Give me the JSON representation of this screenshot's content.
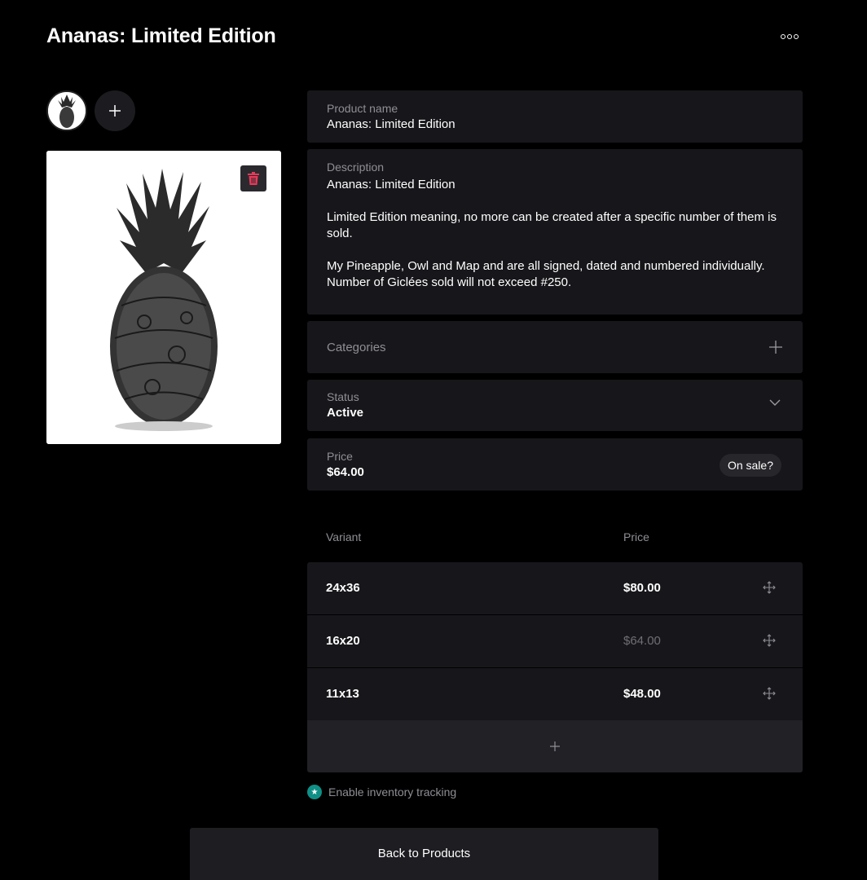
{
  "header": {
    "title": "Ananas: Limited Edition",
    "more_icon": "more-horizontal-icon"
  },
  "images": {
    "thumbnail_alt": "Pineapple illustration thumbnail",
    "main_alt": "Pineapple illustration",
    "add_icon": "plus-icon",
    "delete_icon": "trash-icon",
    "delete_color": "#e8395a"
  },
  "form": {
    "product_name": {
      "label": "Product name",
      "value": "Ananas: Limited Edition"
    },
    "description": {
      "label": "Description",
      "value": "Ananas: Limited Edition\n\nLimited Edition meaning, no more can be created after a specific number of them is sold.\n\nMy Pineapple, Owl and Map and are all signed, dated and numbered individually. Number of Giclées sold will not exceed #250."
    },
    "categories": {
      "label": "Categories",
      "add_icon": "plus-icon"
    },
    "status": {
      "label": "Status",
      "value": "Active",
      "icon": "chevron-down-icon"
    },
    "price": {
      "label": "Price",
      "value": "$64.00",
      "sale_button": "On sale?"
    }
  },
  "variants": {
    "headers": {
      "variant": "Variant",
      "price": "Price"
    },
    "rows": [
      {
        "name": "24x36",
        "price": "$80.00",
        "muted": false
      },
      {
        "name": "16x20",
        "price": "$64.00",
        "muted": true
      },
      {
        "name": "11x13",
        "price": "$48.00",
        "muted": false
      }
    ],
    "drag_icon": "move-icon",
    "add_icon": "plus-icon"
  },
  "inventory": {
    "label": "Enable inventory tracking",
    "icon": "star-icon",
    "icon_color": "#0f8f86"
  },
  "footer": {
    "back_label": "Back to Products"
  }
}
